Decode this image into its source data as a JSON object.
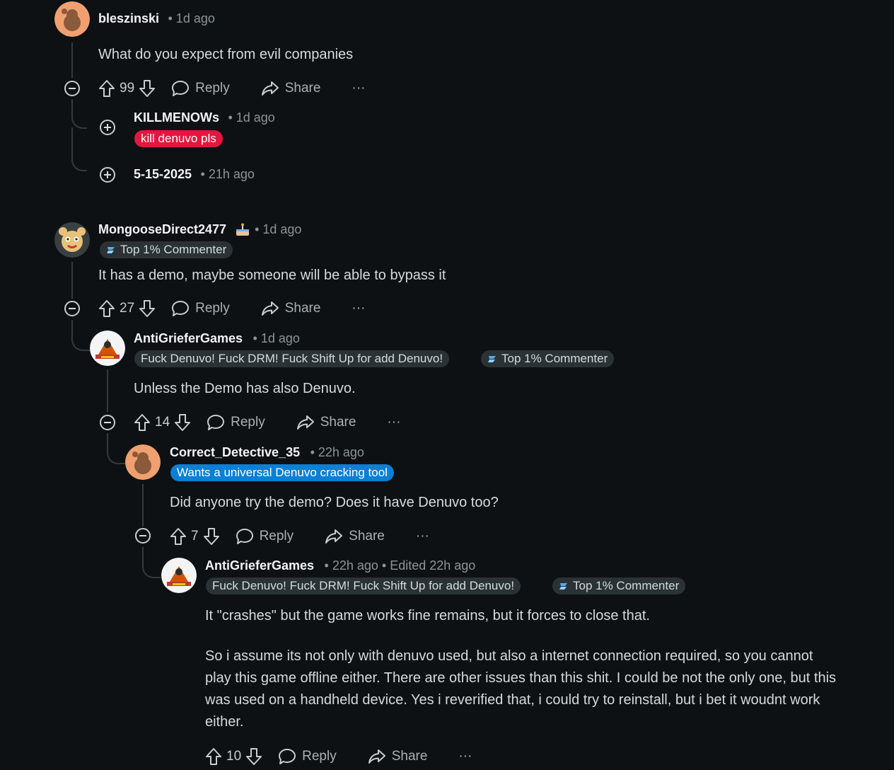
{
  "comments": [
    {
      "username": "bleszinski",
      "meta": "• 1d ago",
      "body": "What do you expect from evil companies",
      "votes": "99",
      "reply_label": "Reply",
      "share_label": "Share",
      "more_label": "···",
      "replies_collapsed": [
        {
          "username": "KILLMENOWs",
          "meta": "• 1d ago",
          "flair": "kill denuvo pls",
          "flair_color": "#e4163f"
        },
        {
          "username": "5-15-2025",
          "meta": "• 21h ago"
        }
      ]
    },
    {
      "username": "MongooseDirect2477",
      "meta": "• 1d ago",
      "flair": "Top 1% Commenter",
      "body": "It has a demo, maybe someone will be able to bypass it",
      "votes": "27",
      "reply_label": "Reply",
      "share_label": "Share",
      "more_label": "···"
    },
    {
      "username": "AntiGrieferGames",
      "meta": "• 1d ago",
      "flair": "Fuck Denuvo! Fuck DRM! Fuck Shift Up for add Denuvo!",
      "badge": "Top 1% Commenter",
      "body": "Unless the Demo has also Denuvo.",
      "votes": "14",
      "reply_label": "Reply",
      "share_label": "Share",
      "more_label": "···"
    },
    {
      "username": "Correct_Detective_35",
      "meta": "• 22h ago",
      "flair": "Wants a universal Denuvo cracking tool",
      "flair_color": "#0a7fd6",
      "body": "Did anyone try the demo? Does it have Denuvo too?",
      "votes": "7",
      "reply_label": "Reply",
      "share_label": "Share",
      "more_label": "···"
    },
    {
      "username": "AntiGrieferGames",
      "meta": "• 22h ago • Edited 22h ago",
      "flair": "Fuck Denuvo! Fuck DRM! Fuck Shift Up for add Denuvo!",
      "badge": "Top 1% Commenter",
      "body_p1": "It \"crashes\" but the game works fine remains, but it forces to close that.",
      "body_p2": "So i assume its not only with denuvo used, but also a internet connection required, so you cannot play this game offline either. There are other issues than this shit. I could be not the only one, but this was used on a handheld device. Yes i reverified that, i could try to reinstall, but i bet it woudnt work either.",
      "votes": "10",
      "reply_label": "Reply",
      "share_label": "Share",
      "more_label": "···"
    }
  ],
  "colors": {
    "background": "#0e1113",
    "thread_line": "#333a3e",
    "flair_gray": "#2a3236",
    "reddit_orange": "#f0a070"
  }
}
